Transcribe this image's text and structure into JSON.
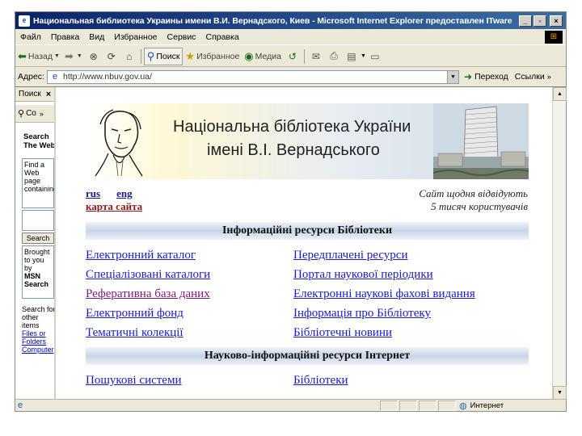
{
  "window": {
    "title": "Национальная библиотека Украины имени В.И. Вернадского, Киев - Microsoft Internet Explorer предоставлен ITware",
    "minimize": "_",
    "maximize": "▫",
    "close": "×"
  },
  "menu": [
    "Файл",
    "Правка",
    "Вид",
    "Избранное",
    "Сервис",
    "Справка"
  ],
  "toolbar": {
    "back_label": "Назад",
    "search_label": "Поиск",
    "favorites_label": "Избранное",
    "media_label": "Медиа"
  },
  "address": {
    "label": "Адрес:",
    "url": "http://www.nbuv.gov.ua/",
    "go_label": "Переход",
    "links_label": "Ссылки"
  },
  "sidebar": {
    "header": "Поиск",
    "close": "×",
    "toolbar_label": "Со",
    "title": "Search The Web",
    "find_text": "Find a Web page containing",
    "search_button": "Search",
    "msn_text": "Brought to you by",
    "msn_bold": "MSN Search",
    "other_text": "Search for other items",
    "other_links": [
      "Files or",
      "Folders",
      "Computer"
    ]
  },
  "page": {
    "banner_line1": "Національна бібліотека України",
    "banner_line2": "імені В.І. Вернадського",
    "lang_rus": "rus",
    "lang_eng": "eng",
    "site_map": "карта сайта",
    "visitors_line1": "Сайт щодня відвідують",
    "visitors_line2": "5 тисяч користувачів",
    "section1_title": "Інформаційні ресурси Бібліотеки",
    "section1_left": [
      "Електронний каталог",
      "Спеціалізовані каталоги",
      "Реферативна база даних",
      "Електронний фонд",
      "Тематичні колекції"
    ],
    "section1_right": [
      "Передплачені ресурси",
      "Портал наукової періодики",
      "Електронні наукові фахові видання",
      "Інформація про Бібліотеку",
      "Бібліотечні новини"
    ],
    "section2_title": "Науково-інформаційні ресурси Інтернет",
    "section2_left": [
      "Пошукові системи"
    ],
    "section2_right": [
      "Бібліотеки"
    ]
  },
  "status": {
    "zone_label": "Интернет"
  },
  "icons": {
    "back": "back-arrow-icon",
    "forward": "forward-arrow-icon",
    "stop": "stop-icon",
    "refresh": "refresh-icon",
    "home": "home-icon",
    "search": "search-icon",
    "favorites": "favorites-icon",
    "media": "media-icon",
    "history": "history-icon",
    "mail": "mail-icon",
    "print": "print-icon",
    "edit": "edit-icon",
    "discuss": "discuss-icon"
  }
}
